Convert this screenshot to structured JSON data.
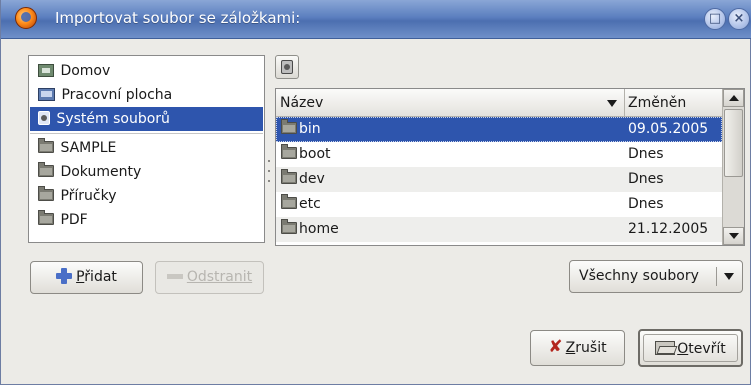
{
  "window": {
    "title": "Importovat soubor se záložkami:"
  },
  "titlebar_buttons": [
    "maximize-icon",
    "close-icon"
  ],
  "places": {
    "items": [
      {
        "label": "Domov",
        "icon": "home-folder-icon"
      },
      {
        "label": "Pracovní plocha",
        "icon": "desktop-icon"
      },
      {
        "label": "Systém souborů",
        "icon": "drive-icon",
        "selected": true
      }
    ],
    "bookmarks": [
      {
        "label": "SAMPLE",
        "icon": "folder-icon"
      },
      {
        "label": "Dokumenty",
        "icon": "folder-icon"
      },
      {
        "label": "Příručky",
        "icon": "folder-icon"
      },
      {
        "label": "PDF",
        "icon": "folder-icon"
      }
    ]
  },
  "path_button_icon": "drive-icon",
  "filelist": {
    "columns": {
      "name": "Název",
      "modified": "Změněn"
    },
    "sort": "descending",
    "rows": [
      {
        "name": "bin",
        "modified": "09.05.2005",
        "selected": true
      },
      {
        "name": "boot",
        "modified": "Dnes"
      },
      {
        "name": "dev",
        "modified": "Dnes"
      },
      {
        "name": "etc",
        "modified": "Dnes"
      },
      {
        "name": "home",
        "modified": "21.12.2005"
      }
    ]
  },
  "buttons": {
    "add": {
      "prefix": "",
      "mnemonic": "P",
      "rest": "řidat",
      "icon": "plus-icon"
    },
    "remove": {
      "label": "Odstranit",
      "icon": "minus-icon",
      "enabled": false
    },
    "filter": {
      "label": "Všechny soubory"
    },
    "cancel": {
      "mnemonic": "Z",
      "rest": "rušit",
      "icon": "cancel-x-icon"
    },
    "open": {
      "mnemonic": "O",
      "rest": "tevřít",
      "icon": "open-folder-icon"
    }
  },
  "colors": {
    "selection": "#2e55ad",
    "titlebar": "#5b7fbf",
    "window_bg": "#ecebe7"
  }
}
